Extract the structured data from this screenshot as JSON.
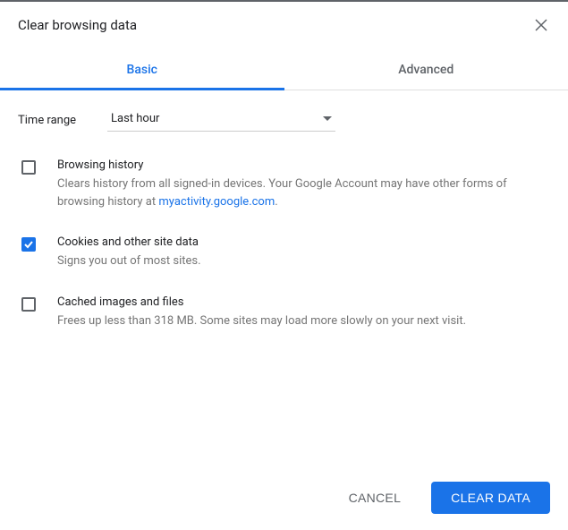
{
  "title": "Clear browsing data",
  "tabs": {
    "basic": "Basic",
    "advanced": "Advanced"
  },
  "timeRange": {
    "label": "Time range",
    "value": "Last hour"
  },
  "options": {
    "browsingHistory": {
      "title": "Browsing history",
      "descPrefix": "Clears history from all signed-in devices. Your Google Account may have other forms of browsing history at ",
      "linkText": "myactivity.google.com",
      "descSuffix": "."
    },
    "cookies": {
      "title": "Cookies and other site data",
      "desc": "Signs you out of most sites."
    },
    "cached": {
      "title": "Cached images and files",
      "desc": "Frees up less than 318 MB. Some sites may load more slowly on your next visit."
    }
  },
  "buttons": {
    "cancel": "CANCEL",
    "clear": "CLEAR DATA"
  }
}
